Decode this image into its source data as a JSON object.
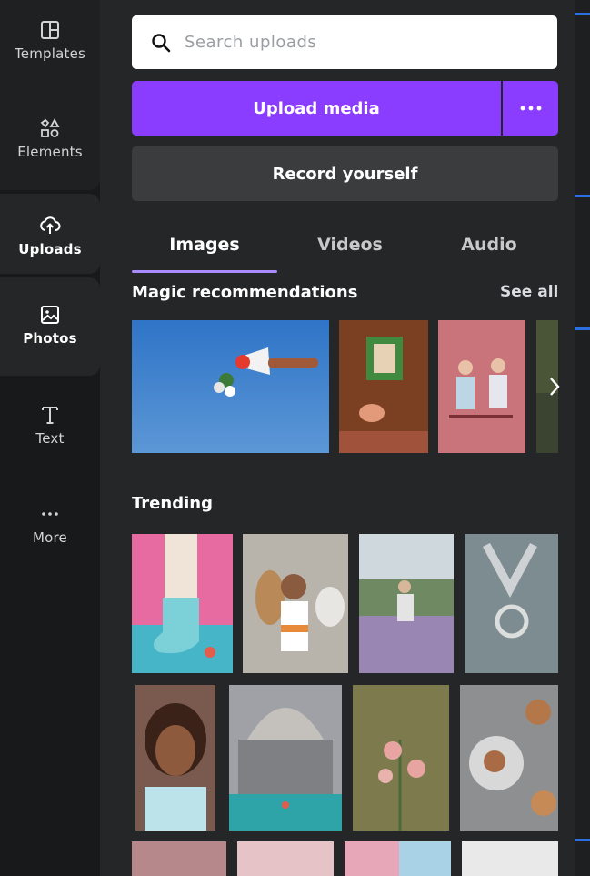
{
  "sidebar": {
    "items": [
      {
        "label": "Templates",
        "icon": "templates-icon"
      },
      {
        "label": "Elements",
        "icon": "elements-icon"
      },
      {
        "label": "Uploads",
        "icon": "uploads-icon",
        "active": true
      },
      {
        "label": "Photos",
        "icon": "photos-icon"
      },
      {
        "label": "Text",
        "icon": "text-icon"
      },
      {
        "label": "More",
        "icon": "more-icon"
      }
    ]
  },
  "search": {
    "placeholder": "Search uploads"
  },
  "actions": {
    "upload_label": "Upload media",
    "record_label": "Record yourself"
  },
  "tabs": [
    {
      "label": "Images",
      "active": true
    },
    {
      "label": "Videos"
    },
    {
      "label": "Audio"
    }
  ],
  "magic": {
    "title": "Magic recommendations",
    "see_all": "See all"
  },
  "trending": {
    "title": "Trending"
  },
  "colors": {
    "accent": "#8b3dff",
    "panel": "#252627",
    "rail": "#18191b",
    "tab_underline": "#a98aff"
  }
}
